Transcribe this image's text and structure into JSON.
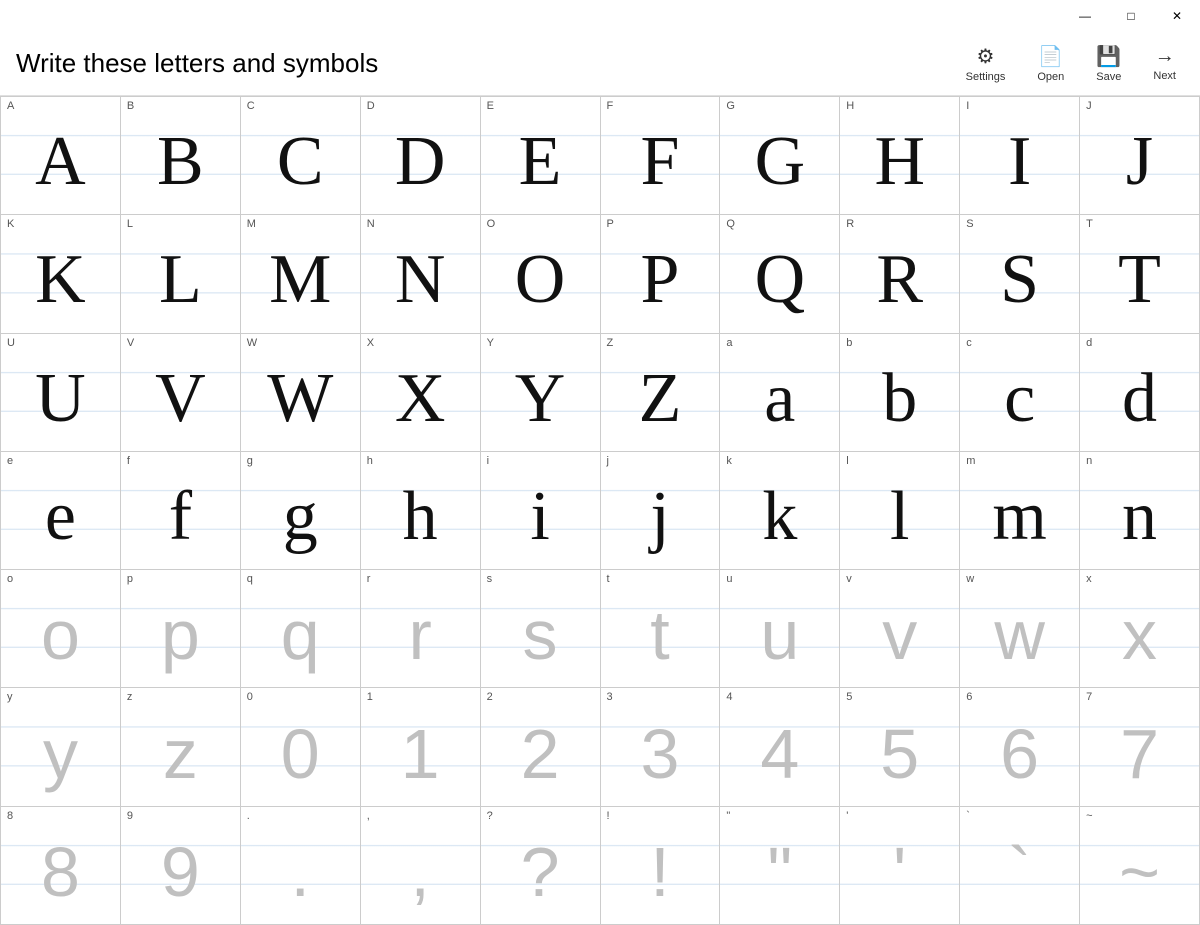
{
  "titlebar": {
    "minimize": "—",
    "maximize": "□",
    "close": "✕"
  },
  "header": {
    "title": "Write these letters and symbols",
    "actions": [
      {
        "id": "settings",
        "label": "Settings",
        "icon": "⚙"
      },
      {
        "id": "open",
        "label": "Open",
        "icon": "📄"
      },
      {
        "id": "save",
        "label": "Save",
        "icon": "💾"
      },
      {
        "id": "next",
        "label": "Next",
        "icon": "→"
      }
    ]
  },
  "cells": [
    {
      "label": "A",
      "handwritten": true,
      "char": "A"
    },
    {
      "label": "B",
      "handwritten": true,
      "char": "B"
    },
    {
      "label": "C",
      "handwritten": true,
      "char": "C"
    },
    {
      "label": "D",
      "handwritten": true,
      "char": "D"
    },
    {
      "label": "E",
      "handwritten": true,
      "char": "E"
    },
    {
      "label": "F",
      "handwritten": true,
      "char": "F"
    },
    {
      "label": "G",
      "handwritten": true,
      "char": "G"
    },
    {
      "label": "H",
      "handwritten": true,
      "char": "H"
    },
    {
      "label": "I",
      "handwritten": true,
      "char": "I"
    },
    {
      "label": "J",
      "handwritten": true,
      "char": "J"
    },
    {
      "label": "K",
      "handwritten": true,
      "char": "K"
    },
    {
      "label": "L",
      "handwritten": true,
      "char": "L"
    },
    {
      "label": "M",
      "handwritten": true,
      "char": "M"
    },
    {
      "label": "N",
      "handwritten": true,
      "char": "N"
    },
    {
      "label": "O",
      "handwritten": true,
      "char": "O"
    },
    {
      "label": "P",
      "handwritten": true,
      "char": "P"
    },
    {
      "label": "Q",
      "handwritten": true,
      "char": "Q"
    },
    {
      "label": "R",
      "handwritten": true,
      "char": "R"
    },
    {
      "label": "S",
      "handwritten": true,
      "char": "S"
    },
    {
      "label": "T",
      "handwritten": true,
      "char": "T"
    },
    {
      "label": "U",
      "handwritten": true,
      "char": "U"
    },
    {
      "label": "V",
      "handwritten": true,
      "char": "V"
    },
    {
      "label": "W",
      "handwritten": true,
      "char": "W"
    },
    {
      "label": "X",
      "handwritten": true,
      "char": "X"
    },
    {
      "label": "Y",
      "handwritten": true,
      "char": "Y"
    },
    {
      "label": "Z",
      "handwritten": true,
      "char": "Z"
    },
    {
      "label": "a",
      "handwritten": true,
      "char": "a"
    },
    {
      "label": "b",
      "handwritten": true,
      "char": "b"
    },
    {
      "label": "c",
      "handwritten": true,
      "char": "c"
    },
    {
      "label": "d",
      "handwritten": true,
      "char": "d"
    },
    {
      "label": "e",
      "handwritten": true,
      "char": "e"
    },
    {
      "label": "f",
      "handwritten": true,
      "char": "f"
    },
    {
      "label": "g",
      "handwritten": true,
      "char": "g"
    },
    {
      "label": "h",
      "handwritten": true,
      "char": "h"
    },
    {
      "label": "i",
      "handwritten": true,
      "char": "i"
    },
    {
      "label": "j",
      "handwritten": true,
      "char": "j"
    },
    {
      "label": "k",
      "handwritten": true,
      "char": "k"
    },
    {
      "label": "l",
      "handwritten": true,
      "char": "l"
    },
    {
      "label": "m",
      "handwritten": true,
      "char": "m"
    },
    {
      "label": "n",
      "handwritten": true,
      "char": "n"
    },
    {
      "label": "o",
      "handwritten": false,
      "char": "o"
    },
    {
      "label": "p",
      "handwritten": false,
      "char": "p"
    },
    {
      "label": "q",
      "handwritten": false,
      "char": "q"
    },
    {
      "label": "r",
      "handwritten": false,
      "char": "r"
    },
    {
      "label": "s",
      "handwritten": false,
      "char": "s"
    },
    {
      "label": "t",
      "handwritten": false,
      "char": "t"
    },
    {
      "label": "u",
      "handwritten": false,
      "char": "u"
    },
    {
      "label": "v",
      "handwritten": false,
      "char": "v"
    },
    {
      "label": "w",
      "handwritten": false,
      "char": "w"
    },
    {
      "label": "x",
      "handwritten": false,
      "char": "x"
    },
    {
      "label": "y",
      "handwritten": false,
      "char": "y"
    },
    {
      "label": "z",
      "handwritten": false,
      "char": "z"
    },
    {
      "label": "0",
      "handwritten": false,
      "char": "0"
    },
    {
      "label": "1",
      "handwritten": false,
      "char": "1"
    },
    {
      "label": "2",
      "handwritten": false,
      "char": "2"
    },
    {
      "label": "3",
      "handwritten": false,
      "char": "3"
    },
    {
      "label": "4",
      "handwritten": false,
      "char": "4"
    },
    {
      "label": "5",
      "handwritten": false,
      "char": "5"
    },
    {
      "label": "6",
      "handwritten": false,
      "char": "6"
    },
    {
      "label": "7",
      "handwritten": false,
      "char": "7"
    },
    {
      "label": "8",
      "handwritten": false,
      "char": "8"
    },
    {
      "label": "9",
      "handwritten": false,
      "char": "9"
    },
    {
      "label": ".",
      "handwritten": false,
      "char": "."
    },
    {
      "label": ",",
      "handwritten": false,
      "char": ","
    },
    {
      "label": "?",
      "handwritten": false,
      "char": "?"
    },
    {
      "label": "!",
      "handwritten": false,
      "char": "!"
    },
    {
      "label": "\"",
      "handwritten": false,
      "char": "\""
    },
    {
      "label": "'",
      "handwritten": false,
      "char": "'"
    },
    {
      "label": "`",
      "handwritten": false,
      "char": "`"
    },
    {
      "label": "~",
      "handwritten": false,
      "char": "~"
    }
  ]
}
